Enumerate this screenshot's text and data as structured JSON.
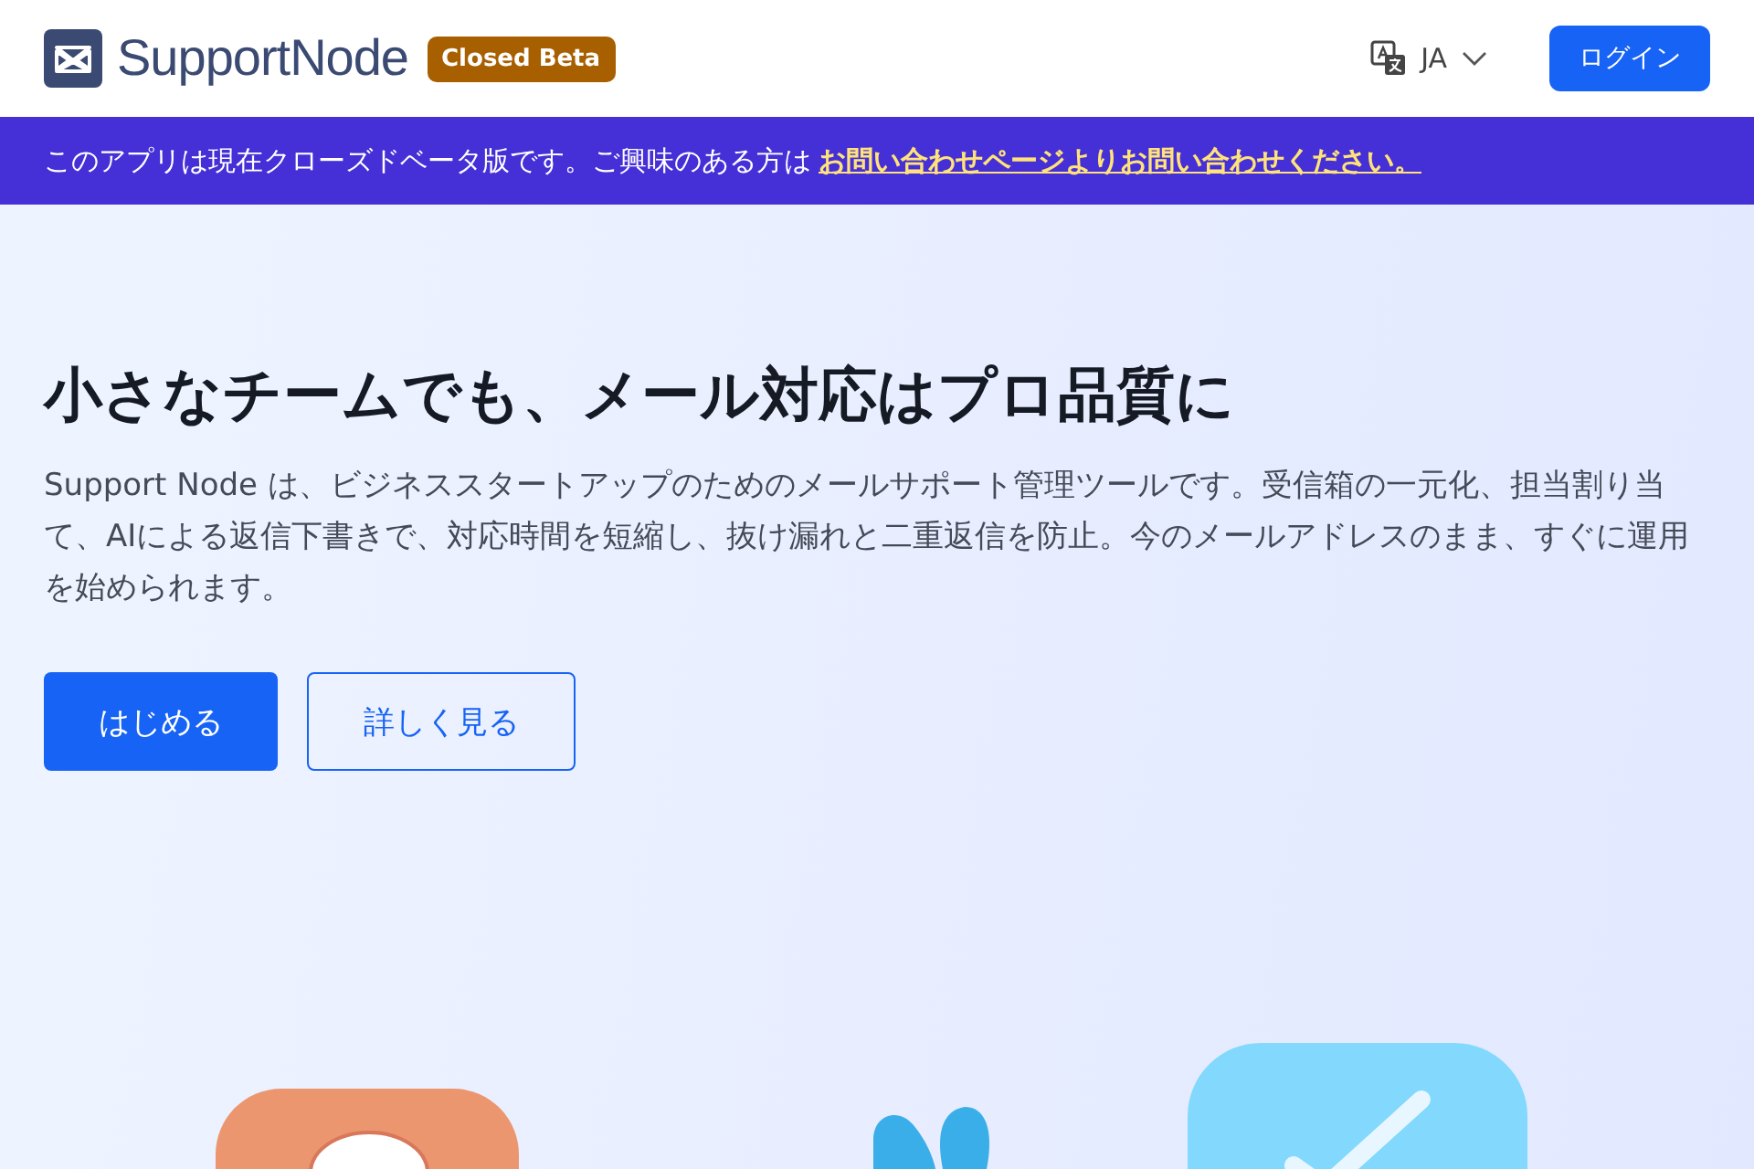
{
  "header": {
    "logo": "SupportNode",
    "badge": "Closed Beta",
    "language": "JA",
    "login_button": "ログイン"
  },
  "banner": {
    "text": "このアプリは現在クローズドベータ版です。ご興味のある方は",
    "link": "お問い合わせページよりお問い合わせください。"
  },
  "hero": {
    "heading": "小さなチームでも、メール対応はプロ品質に",
    "description": "Support Node は、ビジネススタートアップのためのメールサポート管理ツールです。受信箱の一元化、担当割り当て、AIによる返信下書きで、対応時間を短縮し、抜け漏れと二重返信を防止。今のメールアドレスのまま、すぐに運用を始められます。",
    "buttons": [
      {
        "label": "はじめる",
        "kind": "primary"
      },
      {
        "label": "詳しく見る",
        "kind": "secondary"
      }
    ]
  }
}
